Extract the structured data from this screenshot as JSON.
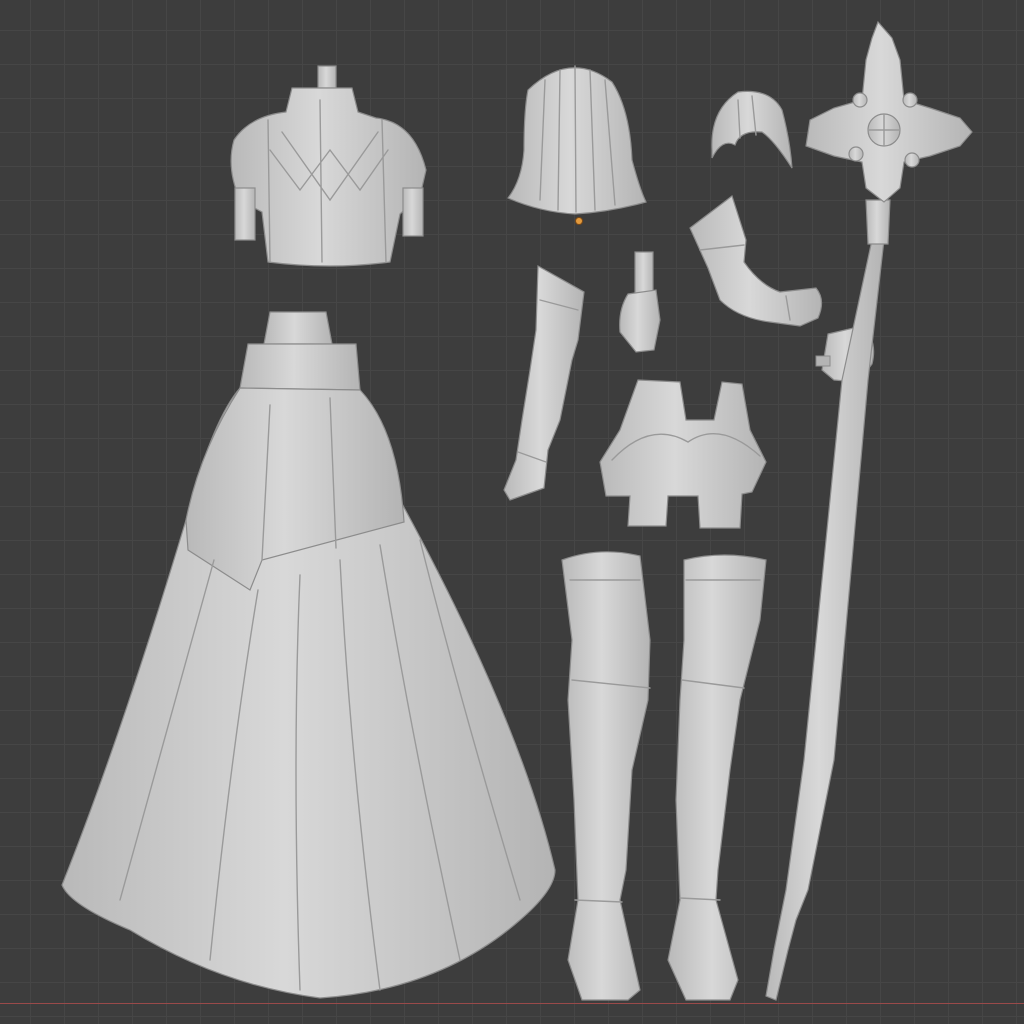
{
  "app": "Blender",
  "viewport": {
    "mode": "solid-shading",
    "view": "orthographic-front",
    "colors": {
      "background": "#3d3d3d",
      "grid": "#464646",
      "x_axis": "#9a4a4a",
      "origin": "#e39a3d",
      "clay": "#cfcfcf"
    }
  },
  "scene_parts": [
    "torso-bodice",
    "skirt",
    "hair-back",
    "hair-ponytail",
    "left-arm-gloved",
    "left-hand",
    "right-arm-with-hand",
    "staff-hand",
    "hip-shorts",
    "left-leg-boot",
    "right-leg-boot",
    "ornate-cross-staff"
  ]
}
